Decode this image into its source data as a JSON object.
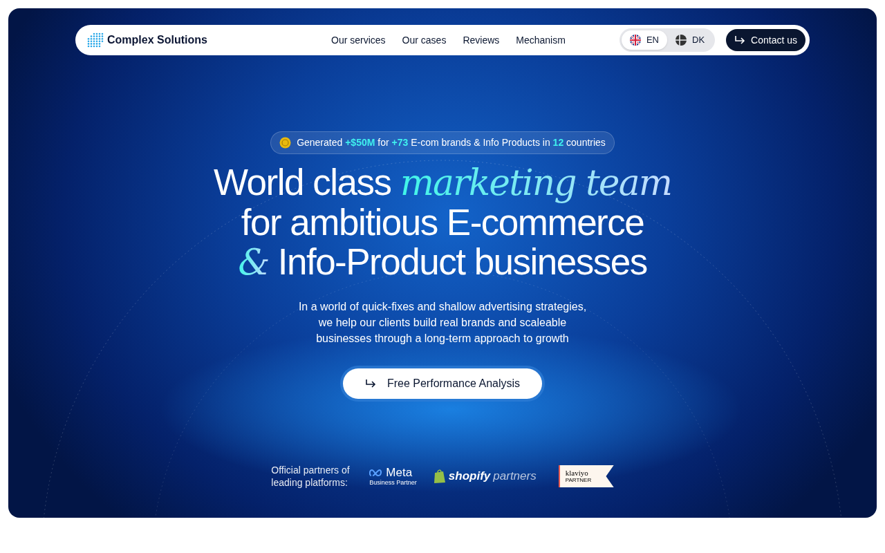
{
  "nav": {
    "brand": "Complex Solutions",
    "links": [
      "Our services",
      "Our cases",
      "Reviews",
      "Mechanism"
    ],
    "languages": [
      {
        "code": "EN",
        "selected": true
      },
      {
        "code": "DK",
        "selected": false
      }
    ],
    "contact": "Contact us"
  },
  "badge": [
    {
      "text": "Generated ",
      "highlight": false
    },
    {
      "text": "+$50M",
      "highlight": true
    },
    {
      "text": " for ",
      "highlight": false
    },
    {
      "text": "+73",
      "highlight": true
    },
    {
      "text": " E-com brands & Info Products in ",
      "highlight": false
    },
    {
      "text": "12",
      "highlight": true
    },
    {
      "text": " countries",
      "highlight": false
    }
  ],
  "headline": [
    [
      {
        "text": "World class ",
        "accent": false
      },
      {
        "text": "marketing team",
        "accent": true
      }
    ],
    [
      {
        "text": "for ambitious E-commerce",
        "accent": false
      }
    ],
    [
      {
        "text": "&",
        "accent": true
      },
      {
        "text": " Info-Product businesses",
        "accent": false
      }
    ]
  ],
  "subtitle": "In a world of quick-fixes and shallow advertising strategies, we help our clients build real brands and scaleable businesses through a long-term approach to growth",
  "cta": "Free Performance Analysis",
  "partners": {
    "label": "Official partners of leading platforms:",
    "meta": {
      "name": "Meta",
      "sub": "Business Partner"
    },
    "shopify": {
      "name": "shopify",
      "sub": "partners"
    },
    "klaviyo": {
      "name": "klaviyo",
      "sub": "PARTNER"
    }
  }
}
